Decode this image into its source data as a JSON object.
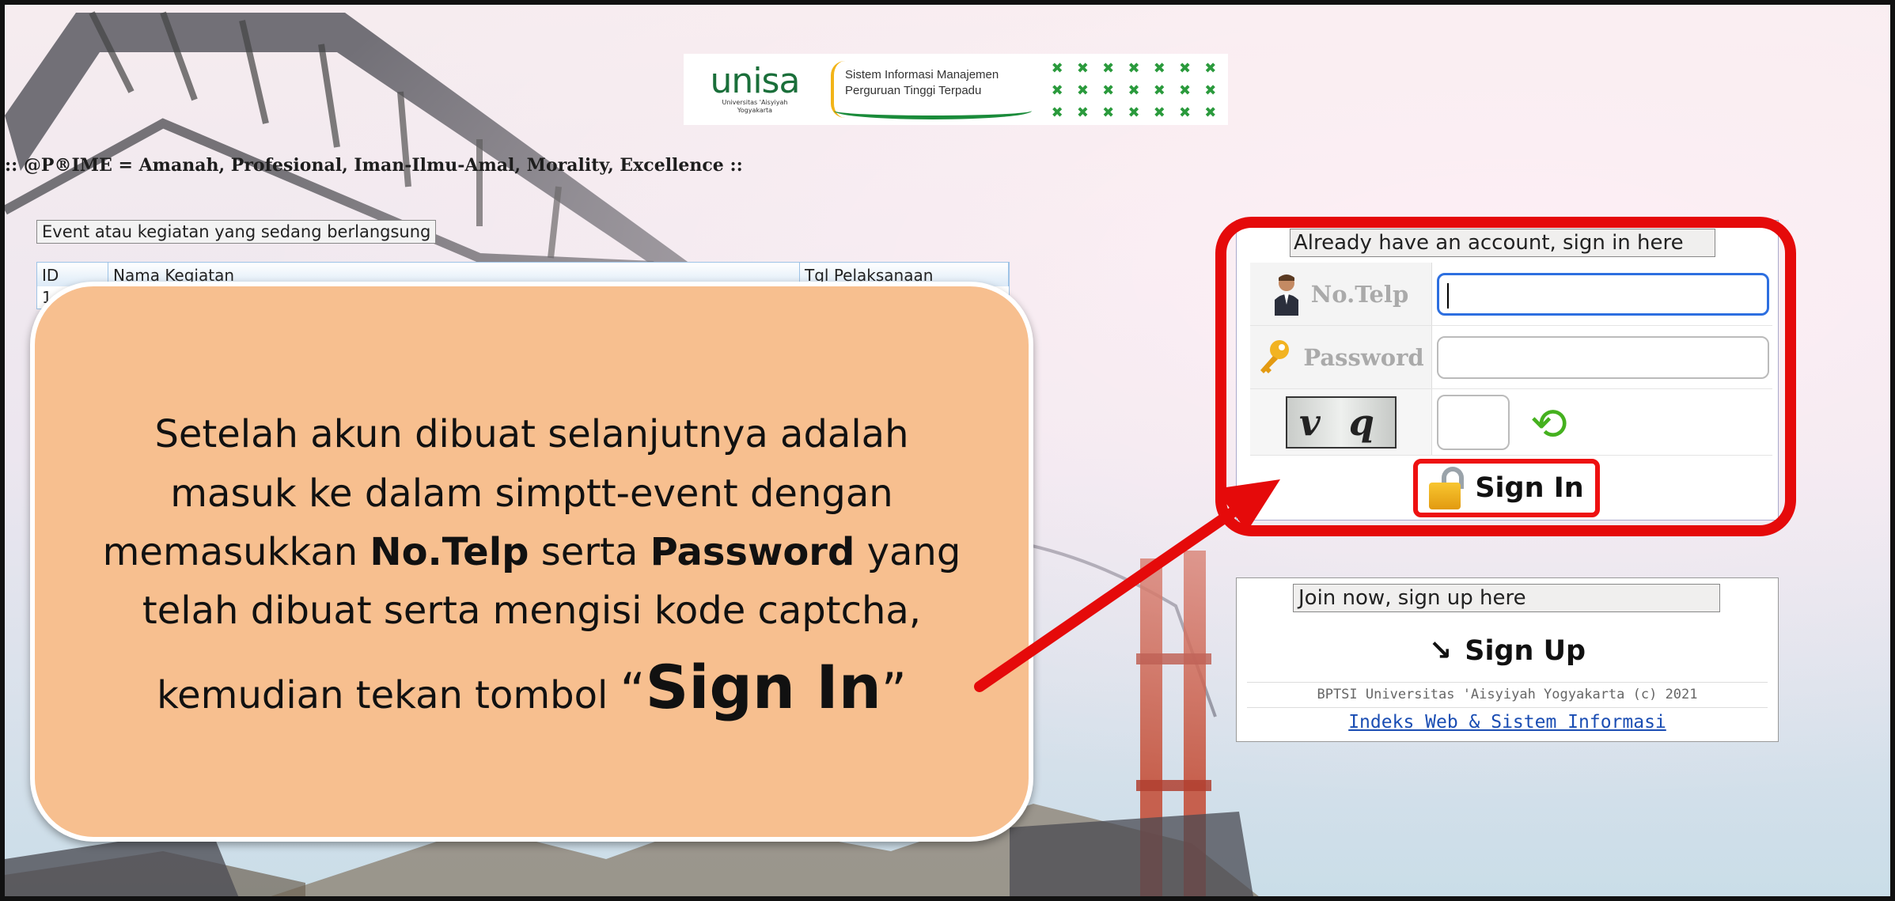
{
  "header": {
    "logo_word": "unisa",
    "logo_sub_line1": "Universitas 'Aisyiyah",
    "logo_sub_line2": "Yogyakarta",
    "system_name_line1": "Sistem Informasi Manajemen",
    "system_name_line2": "Perguruan Tinggi Terpadu",
    "motto": ":: @P®IME = Amanah, Profesional, Iman-Ilmu-Amal, Morality, Excellence ::"
  },
  "events": {
    "legend": "Event atau kegiatan yang sedang berlangsung",
    "columns": [
      "ID",
      "Nama Kegiatan",
      "Tgl Pelaksanaan"
    ],
    "first_row_id": "1"
  },
  "callout": {
    "line1": "Setelah akun dibuat selanjutnya adalah",
    "line2": "masuk ke dalam simptt-event dengan",
    "line3_pre": "memasukkan ",
    "line3_b1": "No.Telp",
    "line3_mid": " serta ",
    "line3_b2": "Password",
    "line3_post": " yang",
    "line4": "telah dibuat serta mengisi kode captcha,",
    "line5_pre": "kemudian tekan tombol ",
    "open_quote": "“",
    "line5_big": "Sign In",
    "close_quote": "”"
  },
  "login": {
    "legend": "Already have an account, sign in here",
    "phone_label": "No.Telp",
    "phone_value": "",
    "password_label": "Password",
    "password_value": "",
    "captcha_text": "v q",
    "captcha_value": "",
    "signin_label": "Sign In"
  },
  "signup": {
    "legend": "Join now, sign up here",
    "signup_label": "Sign Up",
    "arrow_glyph": "↘",
    "copyright": "BPTSI Universitas 'Aisyiyah Yogyakarta (c) 2021",
    "link": "Indeks Web & Sistem Informasi"
  },
  "colors": {
    "highlight": "#e50a0a",
    "callout_bg": "#f7bf8f",
    "focus_border": "#2d6fe0",
    "link": "#1a4db3"
  }
}
